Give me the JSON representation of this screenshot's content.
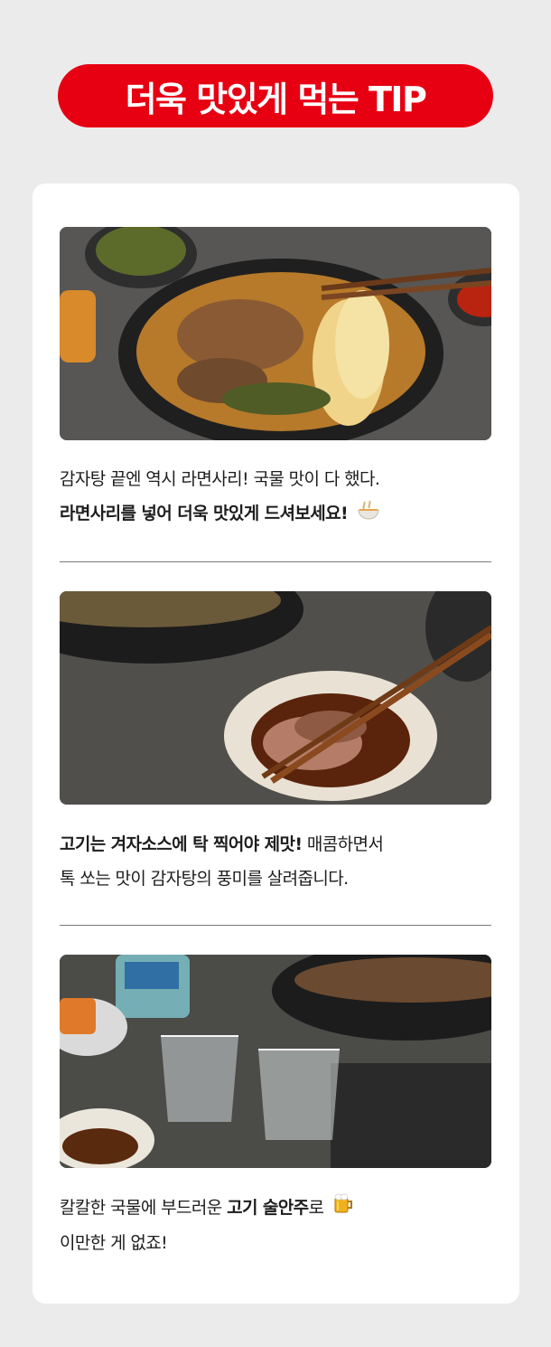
{
  "header": {
    "title": "더욱 맛있게 먹는 TIP"
  },
  "tips": [
    {
      "line1": "감자탕 끝엔 역시 라면사리! 국물 맛이 다 했다.",
      "line2_bold": "라면사리를 넣어 더욱 맛있게 드셔보세요!",
      "emoji_icon": "noodle-bowl-icon"
    },
    {
      "line1_bold": "고기는 겨자소스에 탁 찍어야 제맛!",
      "line1_rest": " 매콤하면서",
      "line2": "톡 쏘는 맛이 감자탕의 풍미를 살려줍니다."
    },
    {
      "line1_pre": "칼칼한 국물에 부드러운 ",
      "line1_bold": "고기 술안주",
      "line1_post": "로",
      "line2": "이만한 게 없죠!",
      "emoji_icon": "beer-mug-icon"
    }
  ],
  "colors": {
    "accent": "#e60012",
    "card": "#ffffff",
    "page": "#ebebeb"
  }
}
